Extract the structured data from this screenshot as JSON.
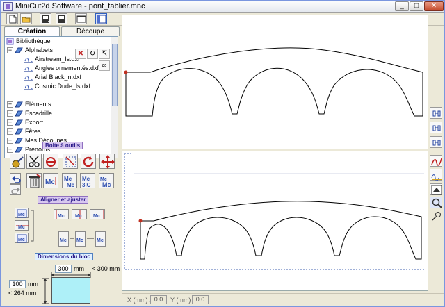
{
  "window": {
    "title": "MiniCut2d Software - pont_tablier.mnc",
    "minimize": "_",
    "maximize": "□",
    "close": "✕"
  },
  "toolbar": {
    "icons": [
      "new-file-icon",
      "open-folder-icon",
      "save-as-icon",
      "save-icon",
      "window-icon",
      "layout-icon"
    ]
  },
  "tabs": [
    {
      "label": "Création",
      "active": true
    },
    {
      "label": "Découpe",
      "active": false
    }
  ],
  "tree": {
    "root": "Bibliothèque",
    "items": [
      {
        "label": "Alphabets",
        "level": 1,
        "expanded": true
      },
      {
        "label": "Airstream_ls.dxf",
        "level": 2
      },
      {
        "label": "Angles ornementés.dxf",
        "level": 2
      },
      {
        "label": "Arial Black_n.dxf",
        "level": 2
      },
      {
        "label": "Cosmic Dude_ls.dxf",
        "level": 2
      },
      {
        "label": "Eléments",
        "level": 1,
        "expanded": false
      },
      {
        "label": "Escadrille",
        "level": 1,
        "expanded": false
      },
      {
        "label": "Export",
        "level": 1,
        "expanded": false
      },
      {
        "label": "Fêtes",
        "level": 1,
        "expanded": false
      },
      {
        "label": "Mes Découpes",
        "level": 1,
        "expanded": false
      },
      {
        "label": "Prénoms",
        "level": 1,
        "expanded": false
      }
    ],
    "actions": {
      "delete": "✕",
      "refresh": "↻",
      "insert": "⇱",
      "binoculars": "∞"
    }
  },
  "toolbox": {
    "title": "Boite à outils",
    "tools_row1": [
      "measure-icon",
      "scissors-icon",
      "cut-point-icon",
      "select-box-icon",
      "rotate-icon",
      "move-icon"
    ],
    "tools_row2": [
      "undo-icon",
      "redo-icon",
      "trash-icon",
      "text-mirror-icon",
      "text-stack-icon",
      "text-flip-icon",
      "text-scale-icon"
    ]
  },
  "align": {
    "title": "Aligner et ajuster"
  },
  "dimensions": {
    "title": "Dimensions du bloc",
    "width_value": "300",
    "width_unit": "mm",
    "width_max": "< 300 mm",
    "height_value": "100",
    "height_unit": "mm",
    "height_max": "< 264 mm"
  },
  "statusbar": {
    "x_label": "X (mm) :",
    "x_value": "0.0",
    "y_label": "Y (mm) :",
    "y_value": "0.0"
  },
  "colors": {
    "path": "#000000",
    "start_point": "#c03020",
    "dashed_border": "#4060b0",
    "section_label_bg": "#d8c8f0"
  }
}
